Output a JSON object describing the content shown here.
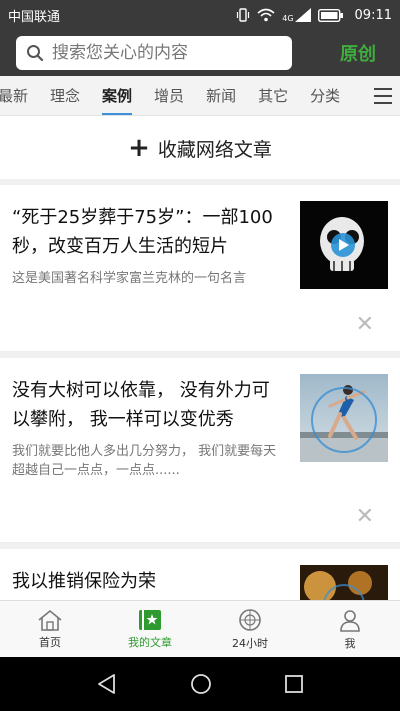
{
  "status_bar": {
    "carrier": "中国联通",
    "network": "4G",
    "time": "09:11"
  },
  "header": {
    "search_placeholder": "搜索您关心的内容",
    "original_label": "原创"
  },
  "tabs": [
    {
      "label": "最新"
    },
    {
      "label": "理念"
    },
    {
      "label": "案例",
      "active": true
    },
    {
      "label": "增员"
    },
    {
      "label": "新闻"
    },
    {
      "label": "其它"
    },
    {
      "label": "分类"
    }
  ],
  "feed": {
    "add_article_label": "收藏网络文章",
    "articles": [
      {
        "title": "“死于25岁葬于75岁”：一部100秒，改变百万人生活的短片",
        "desc": "这是美国著名科学家富兰克林的一句名言"
      },
      {
        "title": "没有大树可以依靠， 没有外力可以攀附， 我一样可以变优秀",
        "desc": "我们就要比他人多出几分努力， 我们就要每天超越自己一点点，一点点......"
      },
      {
        "title": "我以推销保险为荣",
        "desc": ""
      }
    ]
  },
  "bottom_nav": [
    {
      "label": "首页",
      "icon": "home-icon"
    },
    {
      "label": "我的文章",
      "icon": "my-articles-icon",
      "active": true
    },
    {
      "label": "24小时",
      "icon": "clock-icon"
    },
    {
      "label": "我",
      "icon": "user-icon"
    }
  ],
  "colors": {
    "header_bg": "#3a3a3a",
    "accent_green": "#3fae3f",
    "tab_indicator": "#3a8fd8"
  }
}
